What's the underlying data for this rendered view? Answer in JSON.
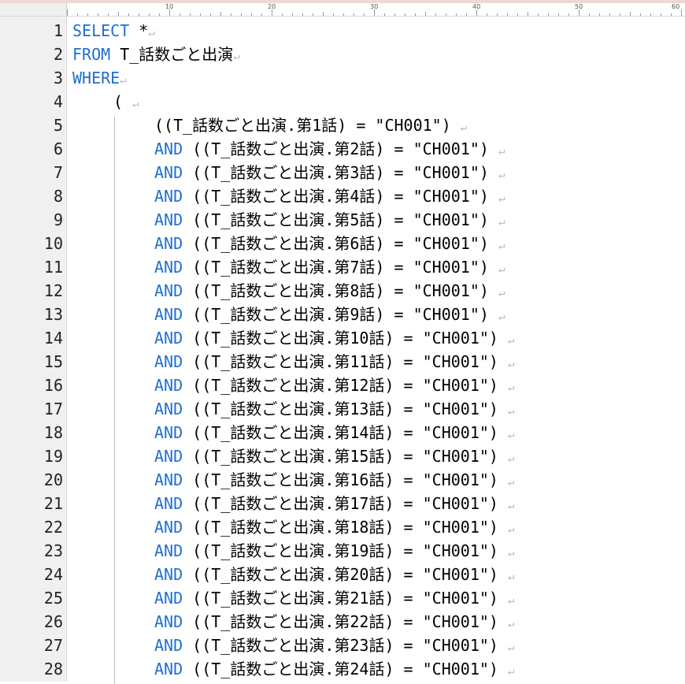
{
  "ruler": {
    "labels": [
      "10",
      "20",
      "30",
      "40",
      "50",
      "60"
    ]
  },
  "lines": [
    {
      "num": "1",
      "indent": 0,
      "parts": [
        {
          "t": "SELECT",
          "kw": true
        },
        {
          "t": " *"
        }
      ]
    },
    {
      "num": "2",
      "indent": 0,
      "parts": [
        {
          "t": "FROM",
          "kw": true
        },
        {
          "t": " T_話数ごと出演"
        }
      ]
    },
    {
      "num": "3",
      "indent": 0,
      "parts": [
        {
          "t": "WHERE",
          "kw": true
        }
      ]
    },
    {
      "num": "4",
      "indent": 1,
      "parts": [
        {
          "t": "( "
        }
      ]
    },
    {
      "num": "5",
      "indent": 2,
      "parts": [
        {
          "t": "((T_話数ごと出演.第1話) = \"CH001\") "
        }
      ]
    },
    {
      "num": "6",
      "indent": 2,
      "parts": [
        {
          "t": "AND",
          "kw": true
        },
        {
          "t": " ((T_話数ごと出演.第2話) = \"CH001\") "
        }
      ]
    },
    {
      "num": "7",
      "indent": 2,
      "parts": [
        {
          "t": "AND",
          "kw": true
        },
        {
          "t": " ((T_話数ごと出演.第3話) = \"CH001\") "
        }
      ]
    },
    {
      "num": "8",
      "indent": 2,
      "parts": [
        {
          "t": "AND",
          "kw": true
        },
        {
          "t": " ((T_話数ごと出演.第4話) = \"CH001\") "
        }
      ]
    },
    {
      "num": "9",
      "indent": 2,
      "parts": [
        {
          "t": "AND",
          "kw": true
        },
        {
          "t": " ((T_話数ごと出演.第5話) = \"CH001\") "
        }
      ]
    },
    {
      "num": "10",
      "indent": 2,
      "parts": [
        {
          "t": "AND",
          "kw": true
        },
        {
          "t": " ((T_話数ごと出演.第6話) = \"CH001\") "
        }
      ]
    },
    {
      "num": "11",
      "indent": 2,
      "parts": [
        {
          "t": "AND",
          "kw": true
        },
        {
          "t": " ((T_話数ごと出演.第7話) = \"CH001\") "
        }
      ]
    },
    {
      "num": "12",
      "indent": 2,
      "parts": [
        {
          "t": "AND",
          "kw": true
        },
        {
          "t": " ((T_話数ごと出演.第8話) = \"CH001\") "
        }
      ]
    },
    {
      "num": "13",
      "indent": 2,
      "parts": [
        {
          "t": "AND",
          "kw": true
        },
        {
          "t": " ((T_話数ごと出演.第9話) = \"CH001\") "
        }
      ]
    },
    {
      "num": "14",
      "indent": 2,
      "parts": [
        {
          "t": "AND",
          "kw": true
        },
        {
          "t": " ((T_話数ごと出演.第10話) = \"CH001\") "
        }
      ]
    },
    {
      "num": "15",
      "indent": 2,
      "parts": [
        {
          "t": "AND",
          "kw": true
        },
        {
          "t": " ((T_話数ごと出演.第11話) = \"CH001\") "
        }
      ]
    },
    {
      "num": "16",
      "indent": 2,
      "parts": [
        {
          "t": "AND",
          "kw": true
        },
        {
          "t": " ((T_話数ごと出演.第12話) = \"CH001\") "
        }
      ]
    },
    {
      "num": "17",
      "indent": 2,
      "parts": [
        {
          "t": "AND",
          "kw": true
        },
        {
          "t": " ((T_話数ごと出演.第13話) = \"CH001\") "
        }
      ]
    },
    {
      "num": "18",
      "indent": 2,
      "parts": [
        {
          "t": "AND",
          "kw": true
        },
        {
          "t": " ((T_話数ごと出演.第14話) = \"CH001\") "
        }
      ]
    },
    {
      "num": "19",
      "indent": 2,
      "parts": [
        {
          "t": "AND",
          "kw": true
        },
        {
          "t": " ((T_話数ごと出演.第15話) = \"CH001\") "
        }
      ]
    },
    {
      "num": "20",
      "indent": 2,
      "parts": [
        {
          "t": "AND",
          "kw": true
        },
        {
          "t": " ((T_話数ごと出演.第16話) = \"CH001\") "
        }
      ]
    },
    {
      "num": "21",
      "indent": 2,
      "parts": [
        {
          "t": "AND",
          "kw": true
        },
        {
          "t": " ((T_話数ごと出演.第17話) = \"CH001\") "
        }
      ]
    },
    {
      "num": "22",
      "indent": 2,
      "parts": [
        {
          "t": "AND",
          "kw": true
        },
        {
          "t": " ((T_話数ごと出演.第18話) = \"CH001\") "
        }
      ]
    },
    {
      "num": "23",
      "indent": 2,
      "parts": [
        {
          "t": "AND",
          "kw": true
        },
        {
          "t": " ((T_話数ごと出演.第19話) = \"CH001\") "
        }
      ]
    },
    {
      "num": "24",
      "indent": 2,
      "parts": [
        {
          "t": "AND",
          "kw": true
        },
        {
          "t": " ((T_話数ごと出演.第20話) = \"CH001\") "
        }
      ]
    },
    {
      "num": "25",
      "indent": 2,
      "parts": [
        {
          "t": "AND",
          "kw": true
        },
        {
          "t": " ((T_話数ごと出演.第21話) = \"CH001\") "
        }
      ]
    },
    {
      "num": "26",
      "indent": 2,
      "parts": [
        {
          "t": "AND",
          "kw": true
        },
        {
          "t": " ((T_話数ごと出演.第22話) = \"CH001\") "
        }
      ]
    },
    {
      "num": "27",
      "indent": 2,
      "parts": [
        {
          "t": "AND",
          "kw": true
        },
        {
          "t": " ((T_話数ごと出演.第23話) = \"CH001\") "
        }
      ]
    },
    {
      "num": "28",
      "indent": 2,
      "parts": [
        {
          "t": "AND",
          "kw": true
        },
        {
          "t": " ((T_話数ごと出演.第24話) = \"CH001\") "
        }
      ]
    }
  ],
  "newline_mark": "↵",
  "colors": {
    "keyword": "#1e6fd0",
    "text": "#000000",
    "gutter_bg": "#f0f0f0",
    "newline_mark": "#b7b7b7"
  }
}
